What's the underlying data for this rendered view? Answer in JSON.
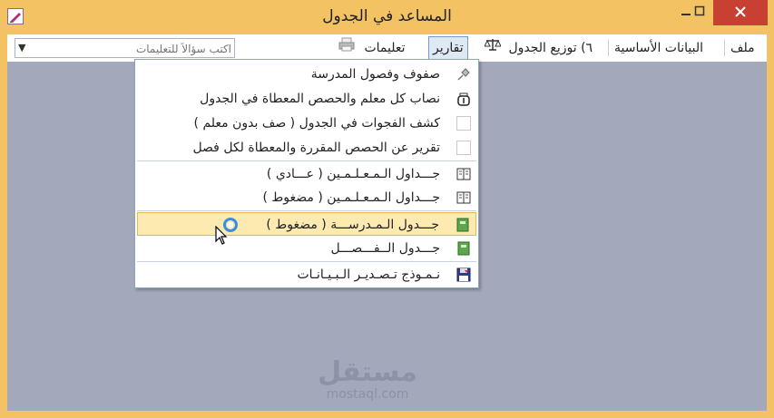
{
  "window": {
    "title": "المساعد في الجدول"
  },
  "menubar": {
    "items": [
      {
        "name": "menu-file",
        "label": "ملف"
      },
      {
        "name": "menu-basic-data",
        "label": "البيانات الأساسية"
      },
      {
        "name": "menu-distribute",
        "label": "٦) توزيع الجدول"
      },
      {
        "name": "menu-reports",
        "label": "تقارير"
      },
      {
        "name": "menu-instructions",
        "label": "تعليمات"
      }
    ],
    "help_placeholder": "اكتب سؤالاً للتعليمات"
  },
  "reports_menu": {
    "items": [
      {
        "label": "صفوف وفصول المدرسة",
        "icon": "pin-icon"
      },
      {
        "label": "نصاب كل معلم والحصص المعطاة في الجدول",
        "icon": "bag-icon"
      },
      {
        "label": "كشف الفجوات في الجدول ( صف بدون معلم )",
        "icon": "blank-icon"
      },
      {
        "label": "تقرير عن الحصص المقررة والمعطاة لكل فصل",
        "icon": "blank-icon"
      },
      {
        "label": "جـــداول الـمـعـلـمـين ( عـــادي )",
        "icon": "book-icon"
      },
      {
        "label": "جـــداول الـمـعـلـمـين ( مضغوط )",
        "icon": "book-icon"
      },
      {
        "label": "جـــدول الـمـدرســـة ( مضغوط )",
        "icon": "green-book-icon",
        "highlighted": true
      },
      {
        "label": "جـــدول الــفـــصـــل",
        "icon": "green-book-icon"
      },
      {
        "label": "نـمـوذج تـصـديـر الـبـيـانـات",
        "icon": "floppy-icon"
      }
    ]
  },
  "watermark": {
    "line1": "مستقل",
    "line2": "mostaql.com"
  }
}
